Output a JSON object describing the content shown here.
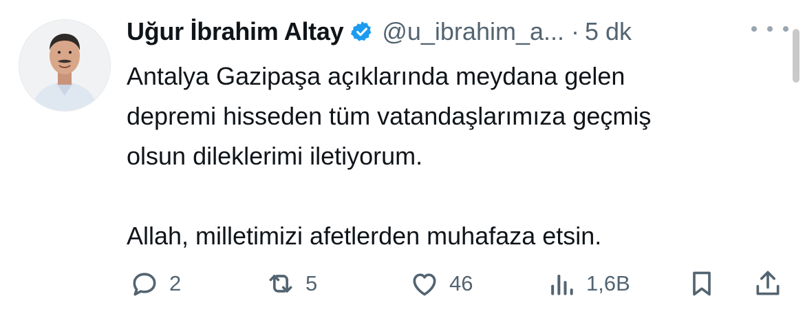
{
  "tweet": {
    "author_name": "Uğur İbrahim Altay",
    "handle": "@u_ibrahim_a...",
    "separator": "·",
    "time": "5 dk",
    "paragraphs": [
      "Antalya Gazipaşa açıklarında meydana gelen",
      "depremi hisseden tüm vatandaşlarımıza geçmiş",
      "olsun dileklerimi iletiyorum.",
      "Allah, milletimizi afetlerden muhafaza etsin."
    ],
    "verified_color": "#1d9bf0"
  },
  "actions": {
    "replies": "2",
    "retweets": "5",
    "likes": "46",
    "views": "1,6B"
  },
  "icons": {
    "avatar": "avatar",
    "verified": "verified-badge-icon",
    "more": "more-icon",
    "reply": "reply-icon",
    "retweet": "retweet-icon",
    "like": "heart-icon",
    "views": "views-chart-icon",
    "bookmark": "bookmark-icon",
    "share": "share-icon"
  }
}
